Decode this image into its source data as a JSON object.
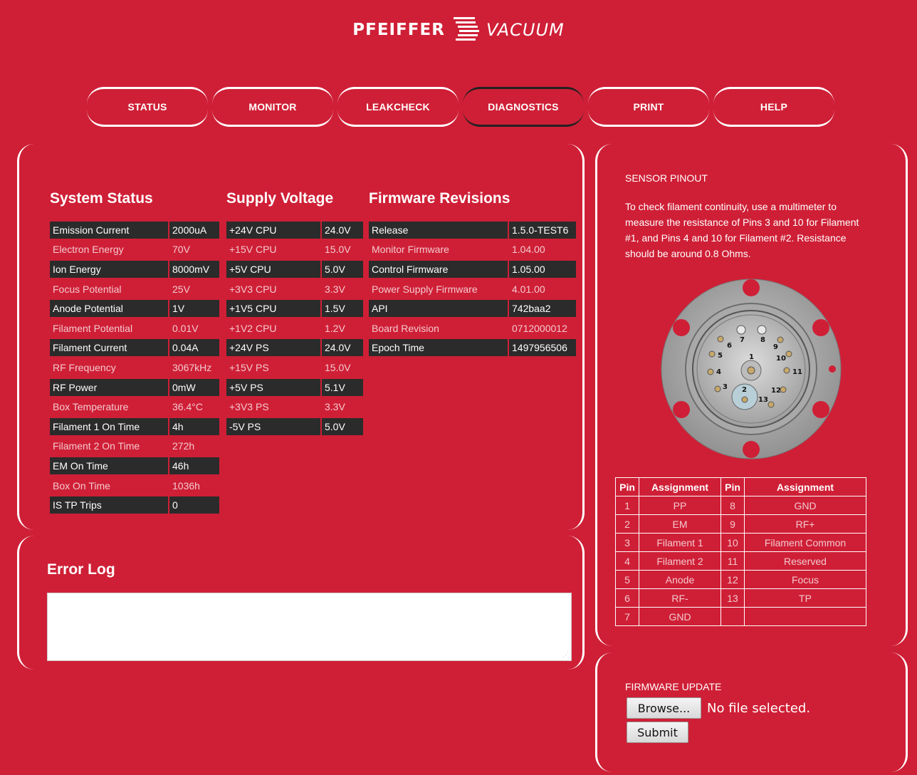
{
  "logo": {
    "brand": "PFEIFFER",
    "sub": "VACUUM"
  },
  "nav": [
    {
      "label": "STATUS",
      "active": false
    },
    {
      "label": "MONITOR",
      "active": false
    },
    {
      "label": "LEAKCHECK",
      "active": false
    },
    {
      "label": "DIAGNOSTICS",
      "active": true
    },
    {
      "label": "PRINT",
      "active": false
    },
    {
      "label": "HELP",
      "active": false
    }
  ],
  "system_status": {
    "title": "System Status",
    "rows": [
      {
        "k": "Emission Current",
        "v": "2000uA"
      },
      {
        "k": "Electron Energy",
        "v": "70V"
      },
      {
        "k": "Ion Energy",
        "v": "8000mV"
      },
      {
        "k": "Focus Potential",
        "v": "25V"
      },
      {
        "k": "Anode Potential",
        "v": "1V"
      },
      {
        "k": "Filament Potential",
        "v": "0.01V"
      },
      {
        "k": "Filament Current",
        "v": "0.04A"
      },
      {
        "k": "RF Frequency",
        "v": "3067kHz"
      },
      {
        "k": "RF Power",
        "v": "0mW"
      },
      {
        "k": "Box Temperature",
        "v": "36.4°C"
      },
      {
        "k": "Filament 1 On Time",
        "v": "4h"
      },
      {
        "k": "Filament 2 On Time",
        "v": "272h"
      },
      {
        "k": "EM On Time",
        "v": "46h"
      },
      {
        "k": "Box On Time",
        "v": "1036h"
      },
      {
        "k": "IS TP Trips",
        "v": "0"
      }
    ]
  },
  "supply_voltage": {
    "title": "Supply Voltage",
    "rows": [
      {
        "k": "+24V CPU",
        "v": "24.0V"
      },
      {
        "k": "+15V CPU",
        "v": "15.0V"
      },
      {
        "k": "+5V CPU",
        "v": "5.0V"
      },
      {
        "k": "+3V3 CPU",
        "v": "3.3V"
      },
      {
        "k": "+1V5 CPU",
        "v": "1.5V"
      },
      {
        "k": "+1V2 CPU",
        "v": "1.2V"
      },
      {
        "k": "+24V PS",
        "v": "24.0V"
      },
      {
        "k": "+15V PS",
        "v": "15.0V"
      },
      {
        "k": "+5V PS",
        "v": "5.1V"
      },
      {
        "k": "+3V3 PS",
        "v": "3.3V"
      },
      {
        "k": "-5V PS",
        "v": "5.0V"
      }
    ]
  },
  "firmware": {
    "title": "Firmware Revisions",
    "rows": [
      {
        "k": "Release",
        "v": "1.5.0-TEST6"
      },
      {
        "k": "Monitor Firmware",
        "v": "1.04.00"
      },
      {
        "k": "Control Firmware",
        "v": "1.05.00"
      },
      {
        "k": "Power Supply Firmware",
        "v": "4.01.00"
      },
      {
        "k": "API",
        "v": "742baa2"
      },
      {
        "k": "Board Revision",
        "v": "0712000012"
      },
      {
        "k": "Epoch Time",
        "v": "1497956506"
      }
    ]
  },
  "sensor": {
    "title": "SENSOR PINOUT",
    "text": "To check filament continuity, use a multimeter to measure the resistance of Pins 3 and 10 for Filament #1, and Pins 4 and 10 for Filament #2. Resistance should be around 0.8 Ohms.",
    "pin_labels": [
      "1",
      "2",
      "3",
      "4",
      "5",
      "6",
      "7",
      "8",
      "9",
      "10",
      "11",
      "12",
      "13"
    ]
  },
  "pin_table": {
    "headers": [
      "Pin",
      "Assignment",
      "Pin",
      "Assignment"
    ],
    "rows": [
      [
        "1",
        "PP",
        "8",
        "GND"
      ],
      [
        "2",
        "EM",
        "9",
        "RF+"
      ],
      [
        "3",
        "Filament 1",
        "10",
        "Filament Common"
      ],
      [
        "4",
        "Filament 2",
        "11",
        "Reserved"
      ],
      [
        "5",
        "Anode",
        "12",
        "Focus"
      ],
      [
        "6",
        "RF-",
        "13",
        "TP"
      ],
      [
        "7",
        "GND",
        "",
        ""
      ]
    ]
  },
  "error_log": {
    "title": "Error Log",
    "value": ""
  },
  "firmware_update": {
    "title": "FIRMWARE UPDATE",
    "browse_label": "Browse...",
    "no_file": "No file selected.",
    "submit_label": "Submit"
  }
}
